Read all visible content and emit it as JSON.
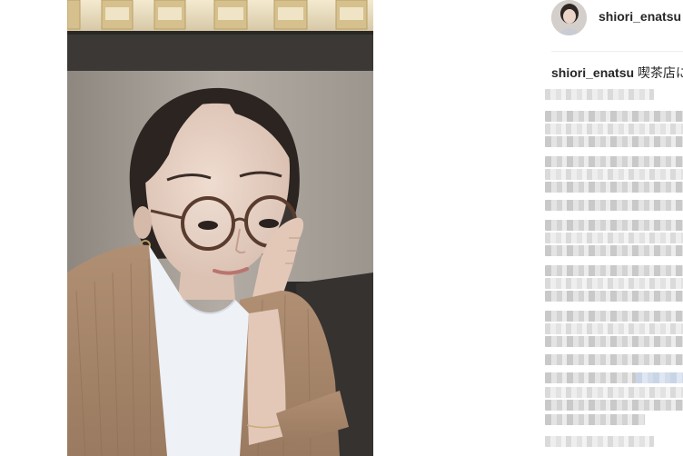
{
  "post": {
    "username": "shiori_enatsu",
    "caption_user": "shiori_enatsu",
    "caption_text": "喫茶店に"
  }
}
